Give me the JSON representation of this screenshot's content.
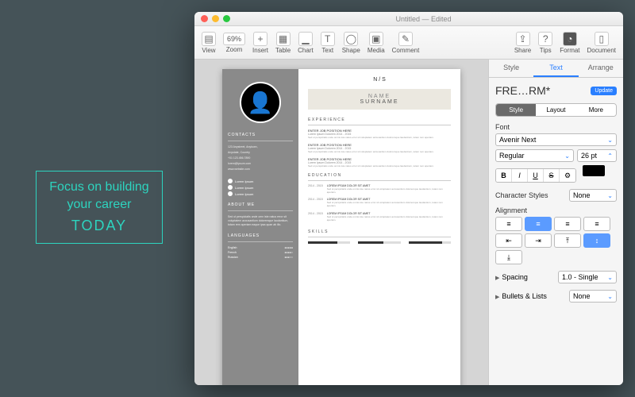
{
  "promo": {
    "l1": "Focus on building",
    "l2": "your career",
    "l3": "TODAY"
  },
  "window": {
    "title": "Untitled — Edited"
  },
  "toolbar": {
    "view": "View",
    "zoom": "Zoom",
    "zoomVal": "69%",
    "insert": "Insert",
    "table": "Table",
    "chart": "Chart",
    "text": "Text",
    "shape": "Shape",
    "media": "Media",
    "comment": "Comment",
    "share": "Share",
    "tips": "Tips",
    "format": "Format",
    "document": "Document"
  },
  "tabs": {
    "style": "Style",
    "text": "Text",
    "arrange": "Arrange"
  },
  "inspector": {
    "styleName": "FRE…RM*",
    "update": "Update",
    "seg": {
      "style": "Style",
      "layout": "Layout",
      "more": "More"
    },
    "fontLbl": "Font",
    "fontFamily": "Avenir Next",
    "fontWeight": "Regular",
    "fontSize": "26 pt",
    "b": "B",
    "i": "I",
    "u": "U",
    "s": "S",
    "charStylesLbl": "Character Styles",
    "charStylesVal": "None",
    "alignLbl": "Alignment",
    "spacingLbl": "Spacing",
    "spacingVal": "1.0 - Single",
    "bulletsLbl": "Bullets & Lists",
    "bulletsVal": "None"
  },
  "resume": {
    "logo": "N / S",
    "name1": "NAME",
    "name2": "SURNAME",
    "contactsH": "CONTACTS",
    "addr1": "123 Anystreet, Anytown,",
    "addr2": "Anystate, Country",
    "phone": "+01 123.456.7890",
    "email": "lorem@ipsum.com",
    "web": "www.website.com",
    "soc": "Lorem Ipsum",
    "aboutH": "ABOUT ME",
    "about": "Sed ut perspiciatis unde omn iste natus error sit voluptatem accusantium doloremque laudantium, totam rem aperiam eaque ipsa quae ab illo.",
    "langH": "LANGUAGES",
    "langs": [
      {
        "n": "English",
        "d": "●●●●●"
      },
      {
        "n": "French",
        "d": "●●●●○"
      },
      {
        "n": "Russian",
        "d": "●●●○○"
      }
    ],
    "expH": "EXPERIENCE",
    "job": "ENTER JOB POSITION HERE",
    "dates": "Lorem Ipsum Dolorem 2014 - 2015",
    "lorem": "Sed ut perspiciatis unde omnis iste natus error sit voluptatem accusantium doloremque laudantium, totam rem aperiam.",
    "eduH": "EDUCATION",
    "edu": [
      {
        "y": "2014 - 2015",
        "t": "LOREM IPSUM DOLOR SIT AMET"
      },
      {
        "y": "2014 - 2015",
        "t": "LOREM IPSUM DOLOR SIT AMET"
      },
      {
        "y": "2014 - 2015",
        "t": "LOREM IPSUM DOLOR SIT AMET"
      }
    ],
    "skillsH": "SKILLS"
  }
}
